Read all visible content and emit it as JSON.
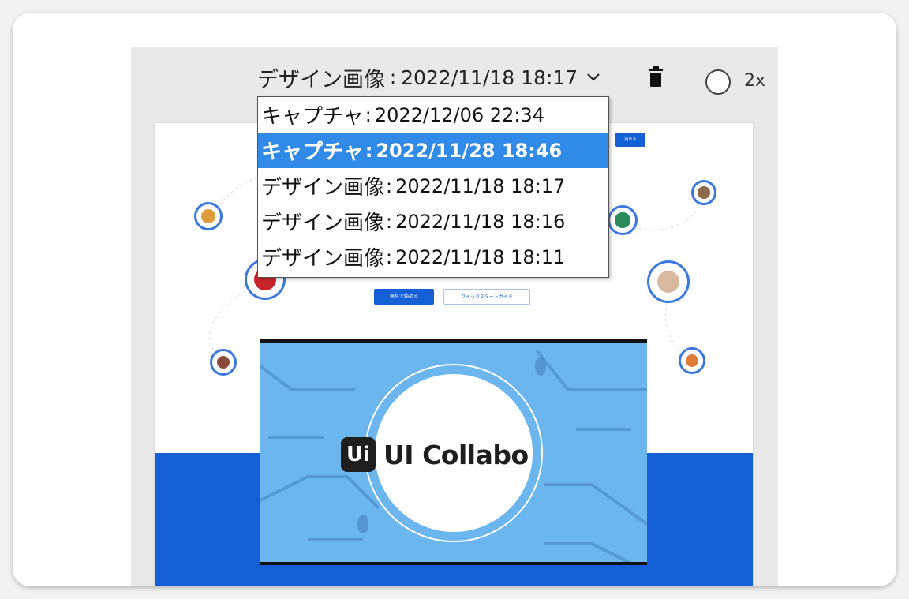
{
  "toolbar": {
    "selected_type": "デザイン画像",
    "separator": ":",
    "selected_date": "2022/11/18 18:17",
    "zoom_label": "2x"
  },
  "dropdown": {
    "options": [
      {
        "type": "キャプチャ",
        "date": "2022/12/06 22:34",
        "selected": false
      },
      {
        "type": "キャプチャ",
        "date": "2022/11/28 18:46",
        "selected": true
      },
      {
        "type": "デザイン画像",
        "date": "2022/11/18 18:17",
        "selected": false
      },
      {
        "type": "デザイン画像",
        "date": "2022/11/18 18:16",
        "selected": false
      },
      {
        "type": "デザイン画像",
        "date": "2022/11/18 18:11",
        "selected": false
      }
    ]
  },
  "preview": {
    "logo_mark": "Ui",
    "logo_text": "UI Collabo",
    "primary_button": "無料で始める",
    "secondary_button": "クイックスタートガイド",
    "top_button": "始める"
  },
  "colors": {
    "accent": "#1560d6",
    "selected_option": "#2f8ae8",
    "video_bg": "#6cb6f0"
  },
  "icons": [
    "chevron-down-icon",
    "trash-icon",
    "radio-icon"
  ]
}
